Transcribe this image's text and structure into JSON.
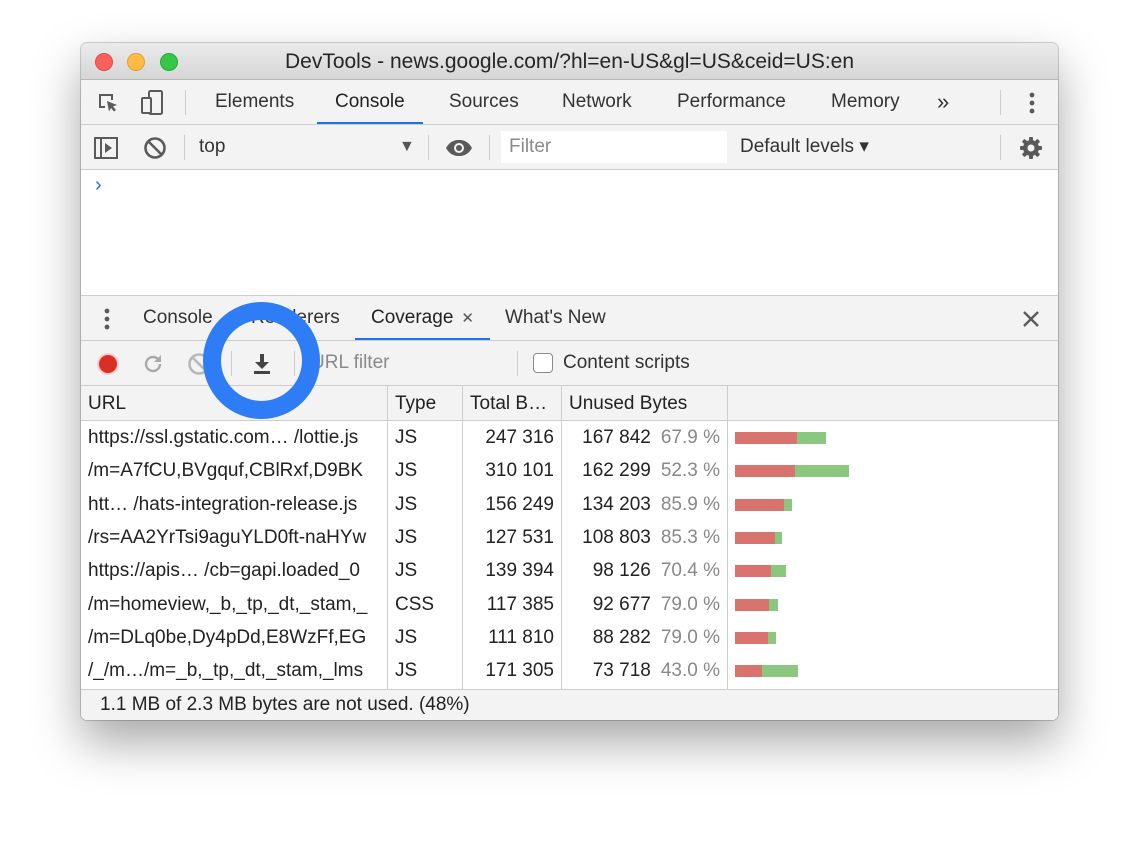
{
  "window": {
    "title": "DevTools - news.google.com/?hl=en-US&gl=US&ceid=US:en"
  },
  "main_tabs": {
    "items": [
      "Elements",
      "Console",
      "Sources",
      "Network",
      "Performance",
      "Memory"
    ],
    "active": "Console",
    "more_label": "»"
  },
  "console_toolbar": {
    "context": "top",
    "filter_placeholder": "Filter",
    "levels_label": "Default levels ▾"
  },
  "console": {
    "prompt": "›"
  },
  "drawer": {
    "tabs": [
      "Console",
      "Renderers",
      "Coverage",
      "What's New"
    ],
    "active": "Coverage",
    "close_tab_label": "✕"
  },
  "coverage_toolbar": {
    "url_filter_placeholder": "URL filter",
    "content_scripts_label": "Content scripts",
    "content_scripts_checked": false
  },
  "coverage": {
    "columns": [
      "URL",
      "Type",
      "Total B…",
      "Unused Bytes"
    ],
    "rows": [
      {
        "url": "https://ssl.gstatic.com… /lottie.js",
        "type": "JS",
        "total": "247 316",
        "unused": "167 842",
        "pct": "67.9 %",
        "total_bytes": 247316,
        "unused_bytes": 167842
      },
      {
        "url": "/m=A7fCU,BVgquf,CBlRxf,D9BK",
        "type": "JS",
        "total": "310 101",
        "unused": "162 299",
        "pct": "52.3 %",
        "total_bytes": 310101,
        "unused_bytes": 162299
      },
      {
        "url": "htt…  /hats-integration-release.js",
        "type": "JS",
        "total": "156 249",
        "unused": "134 203",
        "pct": "85.9 %",
        "total_bytes": 156249,
        "unused_bytes": 134203
      },
      {
        "url": "/rs=AA2YrTsi9aguYLD0ft-naHYw",
        "type": "JS",
        "total": "127 531",
        "unused": "108 803",
        "pct": "85.3 %",
        "total_bytes": 127531,
        "unused_bytes": 108803
      },
      {
        "url": "https://apis… /cb=gapi.loaded_0",
        "type": "JS",
        "total": "139 394",
        "unused": "98 126",
        "pct": "70.4 %",
        "total_bytes": 139394,
        "unused_bytes": 98126
      },
      {
        "url": "/m=homeview,_b,_tp,_dt,_stam,_",
        "type": "CSS",
        "total": "117 385",
        "unused": "92 677",
        "pct": "79.0 %",
        "total_bytes": 117385,
        "unused_bytes": 92677
      },
      {
        "url": "/m=DLq0be,Dy4pDd,E8WzFf,EG",
        "type": "JS",
        "total": "111 810",
        "unused": "88 282",
        "pct": "79.0 %",
        "total_bytes": 111810,
        "unused_bytes": 88282
      },
      {
        "url": "/_/m…/m=_b,_tp,_dt,_stam,_lms",
        "type": "JS",
        "total": "171 305",
        "unused": "73 718",
        "pct": "43.0 %",
        "total_bytes": 171305,
        "unused_bytes": 73718
      }
    ],
    "summary": "1.1 MB of 2.3 MB bytes are not used. (48%)"
  },
  "colors": {
    "accent": "#1a73e8",
    "unused_bar": "#d9736e",
    "used_bar": "#8cc77f",
    "record": "#d93025",
    "highlight_ring": "#2e7cf6"
  }
}
